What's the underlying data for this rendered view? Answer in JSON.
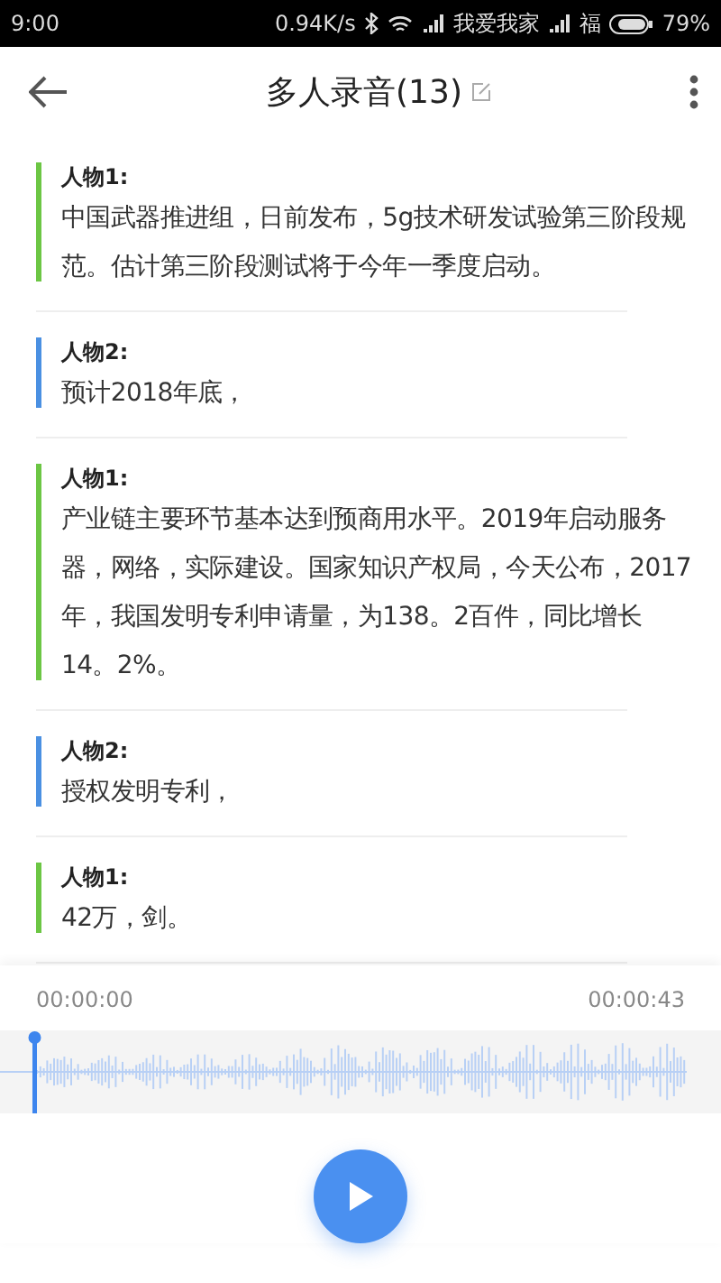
{
  "status_bar": {
    "time": "9:00",
    "speed": "0.94K/s",
    "carrier_1": "我爱我家",
    "carrier_2": "福",
    "battery": "79%"
  },
  "header": {
    "title": "多人录音(13)"
  },
  "transcript": [
    {
      "speaker": "人物1:",
      "text": "中国武器推进组，日前发布，5g技术研发试验第三阶段规范。估计第三阶段测试将于今年一季度启动。",
      "color": "#6cc644"
    },
    {
      "speaker": "人物2:",
      "text": "预计2018年底，",
      "color": "#4a90e2"
    },
    {
      "speaker": "人物1:",
      "text": "产业链主要环节基本达到预商用水平。2019年启动服务器，网络，实际建设。国家知识产权局，今天公布，2017年，我国发明专利申请量，为138。2百件，同比增长14。2%。",
      "color": "#6cc644"
    },
    {
      "speaker": "人物2:",
      "text": "授权发明专利，",
      "color": "#4a90e2"
    },
    {
      "speaker": "人物1:",
      "text": "42万，剑。",
      "color": "#6cc644"
    }
  ],
  "player": {
    "current_time": "00:00:00",
    "total_time": "00:00:43",
    "level": 0
  }
}
